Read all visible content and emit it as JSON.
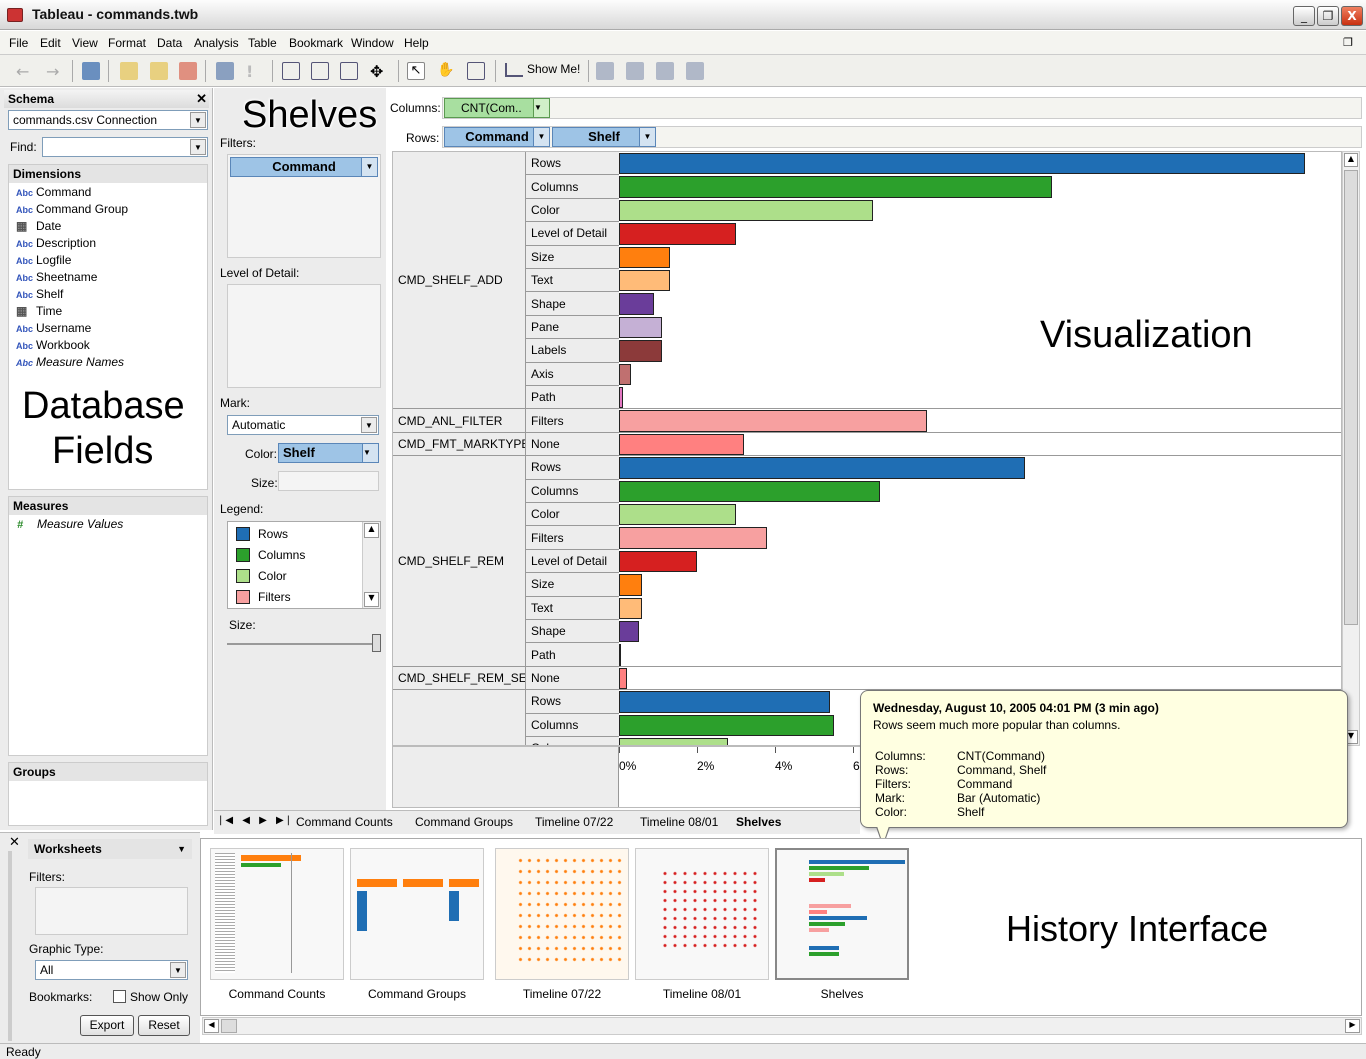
{
  "window": {
    "title": "Tableau - commands.twb",
    "minimize": "_",
    "restore": "❐",
    "close": "X"
  },
  "menu": [
    "File",
    "Edit",
    "View",
    "Format",
    "Data",
    "Analysis",
    "Table",
    "Bookmark",
    "Window",
    "Help"
  ],
  "toolbar": {
    "show_me": "Show Me!"
  },
  "schema": {
    "title": "Schema",
    "connection": "commands.csv Connection",
    "find_label": "Find:",
    "dimensions_title": "Dimensions",
    "dimensions": [
      {
        "type": "Abc",
        "name": "Command"
      },
      {
        "type": "Abc",
        "name": "Command Group"
      },
      {
        "type": "date",
        "name": "Date"
      },
      {
        "type": "Abc",
        "name": "Description"
      },
      {
        "type": "Abc",
        "name": "Logfile"
      },
      {
        "type": "Abc",
        "name": "Sheetname"
      },
      {
        "type": "Abc",
        "name": "Shelf"
      },
      {
        "type": "date",
        "name": "Time"
      },
      {
        "type": "Abc",
        "name": "Username"
      },
      {
        "type": "Abc",
        "name": "Workbook"
      },
      {
        "type": "Abc",
        "name": "Measure Names"
      }
    ],
    "measures_title": "Measures",
    "measures": [
      {
        "type": "#",
        "name": "Measure Values"
      }
    ],
    "groups_title": "Groups"
  },
  "annotations": {
    "database_fields_1": "Database",
    "database_fields_2": "Fields",
    "shelves": "Shelves",
    "visualization": "Visualization",
    "history": "History Interface"
  },
  "shelves": {
    "columns_label": "Columns:",
    "columns_pill": "CNT(Com..",
    "rows_label": "Rows:",
    "rows_pills": [
      "Command",
      "Shelf"
    ],
    "filters_label": "Filters:",
    "filters_pill": "Command",
    "lod_label": "Level of Detail:",
    "mark_label": "Mark:",
    "mark_value": "Automatic",
    "color_label": "Color:",
    "color_value": "Shelf",
    "size_label": "Size:",
    "legend_label": "Legend:",
    "legend": [
      {
        "name": "Rows",
        "color": "#1f6eb4"
      },
      {
        "name": "Columns",
        "color": "#2ca02c"
      },
      {
        "name": "Color",
        "color": "#addf8a"
      },
      {
        "name": "Filters",
        "color": "#f7a0a0"
      }
    ],
    "size_slider_label": "Size:"
  },
  "chart_data": {
    "type": "bar",
    "orientation": "horizontal",
    "x_axis_ticks": [
      "0%",
      "2%",
      "4%",
      "6%"
    ],
    "xlim": [
      0,
      0.18
    ],
    "groups": [
      {
        "command": "CMD_SHELF_ADD",
        "rows": [
          {
            "shelf": "Rows",
            "value": 17.6,
            "color": "#1f6eb4"
          },
          {
            "shelf": "Columns",
            "value": 11.1,
            "color": "#2ca02c"
          },
          {
            "shelf": "Color",
            "value": 6.5,
            "color": "#addf8a"
          },
          {
            "shelf": "Level of Detail",
            "value": 3.0,
            "color": "#d62020"
          },
          {
            "shelf": "Size",
            "value": 1.3,
            "color": "#ff7f0e"
          },
          {
            "shelf": "Text",
            "value": 1.3,
            "color": "#ffbb78"
          },
          {
            "shelf": "Shape",
            "value": 0.9,
            "color": "#6a3d9a"
          },
          {
            "shelf": "Pane",
            "value": 1.1,
            "color": "#c5b0d5"
          },
          {
            "shelf": "Labels",
            "value": 1.1,
            "color": "#8c3a3a"
          },
          {
            "shelf": "Axis",
            "value": 0.3,
            "color": "#c07070"
          },
          {
            "shelf": "Path",
            "value": 0.1,
            "color": "#e377c2"
          }
        ]
      },
      {
        "command": "CMD_ANL_FILTER",
        "rows": [
          {
            "shelf": "Filters",
            "value": 7.9,
            "color": "#f7a0a0"
          }
        ]
      },
      {
        "command": "CMD_FMT_MARKTYPE",
        "rows": [
          {
            "shelf": "None",
            "value": 3.2,
            "color": "#ff8080"
          }
        ]
      },
      {
        "command": "CMD_SHELF_REM",
        "rows": [
          {
            "shelf": "Rows",
            "value": 10.4,
            "color": "#1f6eb4"
          },
          {
            "shelf": "Columns",
            "value": 6.7,
            "color": "#2ca02c"
          },
          {
            "shelf": "Color",
            "value": 3.0,
            "color": "#addf8a"
          },
          {
            "shelf": "Filters",
            "value": 3.8,
            "color": "#f7a0a0"
          },
          {
            "shelf": "Level of Detail",
            "value": 2.0,
            "color": "#d62020"
          },
          {
            "shelf": "Size",
            "value": 0.6,
            "color": "#ff7f0e"
          },
          {
            "shelf": "Text",
            "value": 0.6,
            "color": "#ffbb78"
          },
          {
            "shelf": "Shape",
            "value": 0.5,
            "color": "#6a3d9a"
          },
          {
            "shelf": "Path",
            "value": 0.05,
            "color": "#e377c2"
          }
        ]
      },
      {
        "command": "CMD_SHELF_REM_SEL",
        "rows": [
          {
            "shelf": "None",
            "value": 0.2,
            "color": "#ff8080"
          }
        ]
      },
      {
        "command": "",
        "rows": [
          {
            "shelf": "Rows",
            "value": 5.4,
            "color": "#1f6eb4"
          },
          {
            "shelf": "Columns",
            "value": 5.5,
            "color": "#2ca02c"
          },
          {
            "shelf": "Color",
            "value": 2.8,
            "color": "#addf8a"
          }
        ]
      }
    ]
  },
  "tooltip": {
    "title": "Wednesday, August 10, 2005 04:01 PM (3 min ago)",
    "note": "Rows seem much more popular than columns.",
    "fields": [
      {
        "k": "Columns:",
        "v": "CNT(Command)"
      },
      {
        "k": "Rows:",
        "v": "Command, Shelf"
      },
      {
        "k": "Filters:",
        "v": "Command"
      },
      {
        "k": "Mark:",
        "v": "Bar (Automatic)"
      },
      {
        "k": "Color:",
        "v": "Shelf"
      }
    ]
  },
  "tabs": [
    "Command Counts",
    "Command Groups",
    "Timeline 07/22",
    "Timeline 08/01",
    "Shelves"
  ],
  "worksheets": {
    "title": "Worksheets",
    "filters_label": "Filters:",
    "graphic_type_label": "Graphic Type:",
    "graphic_type_value": "All",
    "bookmarks_label": "Bookmarks:",
    "show_only": "Show Only",
    "export": "Export",
    "reset": "Reset"
  },
  "history": [
    "Command Counts",
    "Command Groups",
    "Timeline 07/22",
    "Timeline 08/01",
    "Shelves"
  ],
  "status": "Ready"
}
